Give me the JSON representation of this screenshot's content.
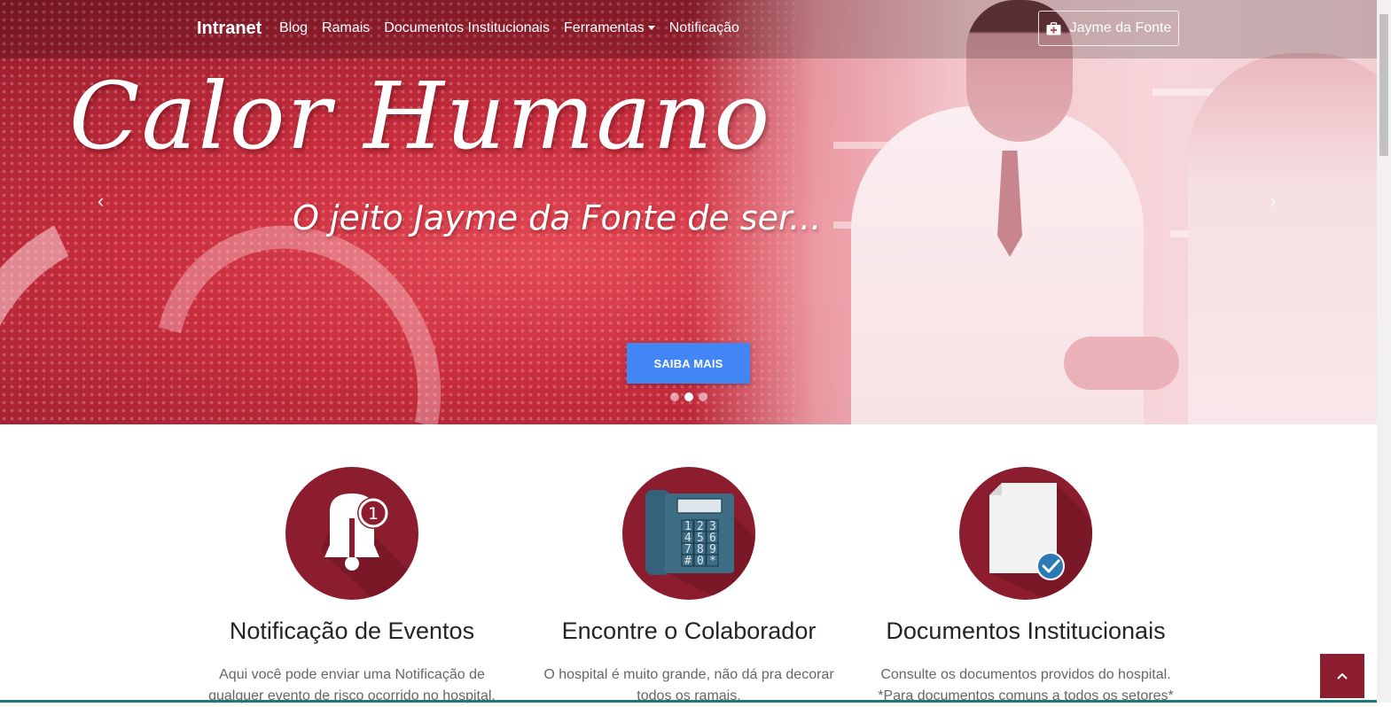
{
  "navbar": {
    "brand": "Intranet",
    "links": [
      "Blog",
      "Ramais",
      "Documentos Institucionais",
      "Ferramentas",
      "Notificação"
    ],
    "user_button": "Jayme da Fonte"
  },
  "hero": {
    "title": "Calor Humano",
    "subtitle": "O jeito Jayme da Fonte de ser...",
    "cta": "SAIBA MAIS",
    "prev_arrow": "‹",
    "next_arrow": "›",
    "active_slide": 2,
    "slide_count": 3
  },
  "features": [
    {
      "icon": "bell-notification-icon",
      "title": "Notificação de Eventos",
      "line1": "Aqui você pode enviar uma Notificação de",
      "line2": "qualquer evento de risco ocorrido no hospital."
    },
    {
      "icon": "telephone-icon",
      "title": "Encontre o Colaborador",
      "line1": "O hospital é muito grande, não dá pra decorar",
      "line2": "todos os ramais."
    },
    {
      "icon": "document-check-icon",
      "title": "Documentos Institucionais",
      "line1": "Consulte os documentos providos do hospital.",
      "line2": "*Para documentos comuns a todos os setores*"
    }
  ],
  "colors": {
    "brand_dark_red": "#8c1d2f",
    "cta_blue": "#4285f4",
    "phone_blue": "#3d6e86",
    "check_blue": "#2b79b5"
  },
  "scroll_top_icon": "chevron-up-icon"
}
